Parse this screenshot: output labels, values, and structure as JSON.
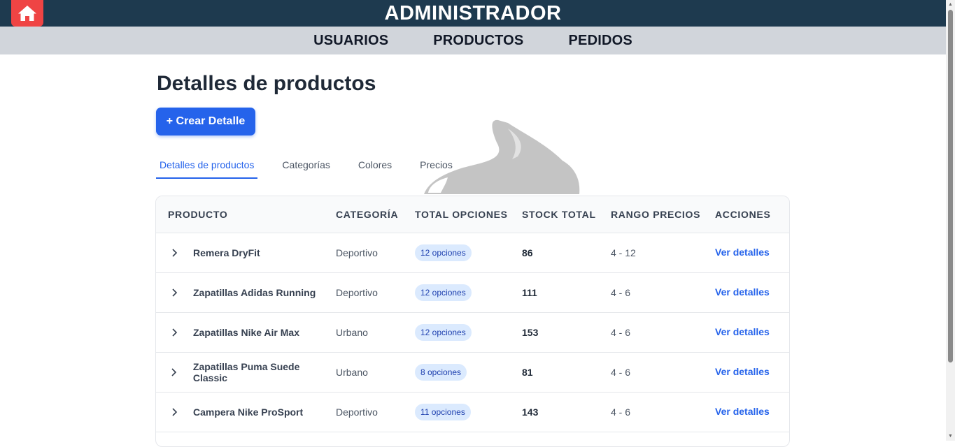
{
  "header": {
    "title": "ADMINISTRADOR",
    "home_icon": "home-icon",
    "accent_color": "#ef4444",
    "bar_color": "#1e3a4f"
  },
  "nav": {
    "items": [
      {
        "label": "USUARIOS"
      },
      {
        "label": "PRODUCTOS"
      },
      {
        "label": "PEDIDOS"
      }
    ]
  },
  "main": {
    "title": "Detalles de productos",
    "create_button": "+ Crear Detalle",
    "tabs": [
      {
        "label": "Detalles de productos",
        "active": true
      },
      {
        "label": "Categorías",
        "active": false
      },
      {
        "label": "Colores",
        "active": false
      },
      {
        "label": "Precios",
        "active": false
      }
    ]
  },
  "table": {
    "headers": {
      "producto": "PRODUCTO",
      "categoria": "CATEGORÍA",
      "total_opciones": "TOTAL OPCIONES",
      "stock_total": "STOCK TOTAL",
      "rango_precios": "RANGO PRECIOS",
      "acciones": "ACCIONES"
    },
    "rows": [
      {
        "producto": "Remera DryFit",
        "categoria": "Deportivo",
        "opciones": "12 opciones",
        "stock": "86",
        "rango": "4 - 12",
        "accion": "Ver detalles"
      },
      {
        "producto": "Zapatillas Adidas Running",
        "categoria": "Deportivo",
        "opciones": "12 opciones",
        "stock": "111",
        "rango": "4 - 6",
        "accion": "Ver detalles"
      },
      {
        "producto": "Zapatillas Nike Air Max",
        "categoria": "Urbano",
        "opciones": "12 opciones",
        "stock": "153",
        "rango": "4 - 6",
        "accion": "Ver detalles"
      },
      {
        "producto": "Zapatillas Puma Suede Classic",
        "categoria": "Urbano",
        "opciones": "8 opciones",
        "stock": "81",
        "rango": "4 - 6",
        "accion": "Ver detalles"
      },
      {
        "producto": "Campera Nike ProSport",
        "categoria": "Deportivo",
        "opciones": "11 opciones",
        "stock": "143",
        "rango": "4 - 6",
        "accion": "Ver detalles"
      }
    ]
  }
}
